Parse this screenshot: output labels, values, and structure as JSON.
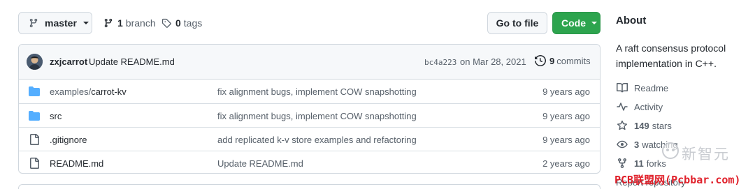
{
  "toolbar": {
    "branch": "master",
    "branches_count": "1",
    "branches_label": "branch",
    "tags_count": "0",
    "tags_label": "tags",
    "goto_label": "Go to file",
    "code_label": "Code"
  },
  "latest_commit": {
    "author": "zxjcarrot",
    "message": "Update README.md",
    "hash": "bc4a223",
    "date": "on Mar 28, 2021",
    "commits_count": "9",
    "commits_label": "commits"
  },
  "files": [
    {
      "name_prefix": "examples/",
      "name": "carrot-kv",
      "type": "folder",
      "message": "fix alignment bugs, implement COW snapshotting",
      "age": "9 years ago"
    },
    {
      "name_prefix": "",
      "name": "src",
      "type": "folder",
      "message": "fix alignment bugs, implement COW snapshotting",
      "age": "9 years ago"
    },
    {
      "name_prefix": "",
      "name": ".gitignore",
      "type": "file",
      "message": "add replicated k-v store examples and refactoring",
      "age": "9 years ago"
    },
    {
      "name_prefix": "",
      "name": "README.md",
      "type": "file",
      "message": "Update README.md",
      "age": "2 years ago"
    }
  ],
  "about": {
    "title": "About",
    "description": "A raft consensus protocol implementation in C++.",
    "readme": "Readme",
    "activity": "Activity",
    "stars_count": "149",
    "stars_label": "stars",
    "watching_count": "3",
    "watching_label": "watching",
    "forks_count": "11",
    "forks_label": "forks",
    "report_label": "Report repository"
  },
  "watermark": {
    "brand_cn": "新智元",
    "site": "PCB联盟网(Pcbbar.com)"
  },
  "colors": {
    "accent_green": "#2da44e",
    "folder_blue": "#54aeff",
    "watermark_red": "#e0212b"
  }
}
